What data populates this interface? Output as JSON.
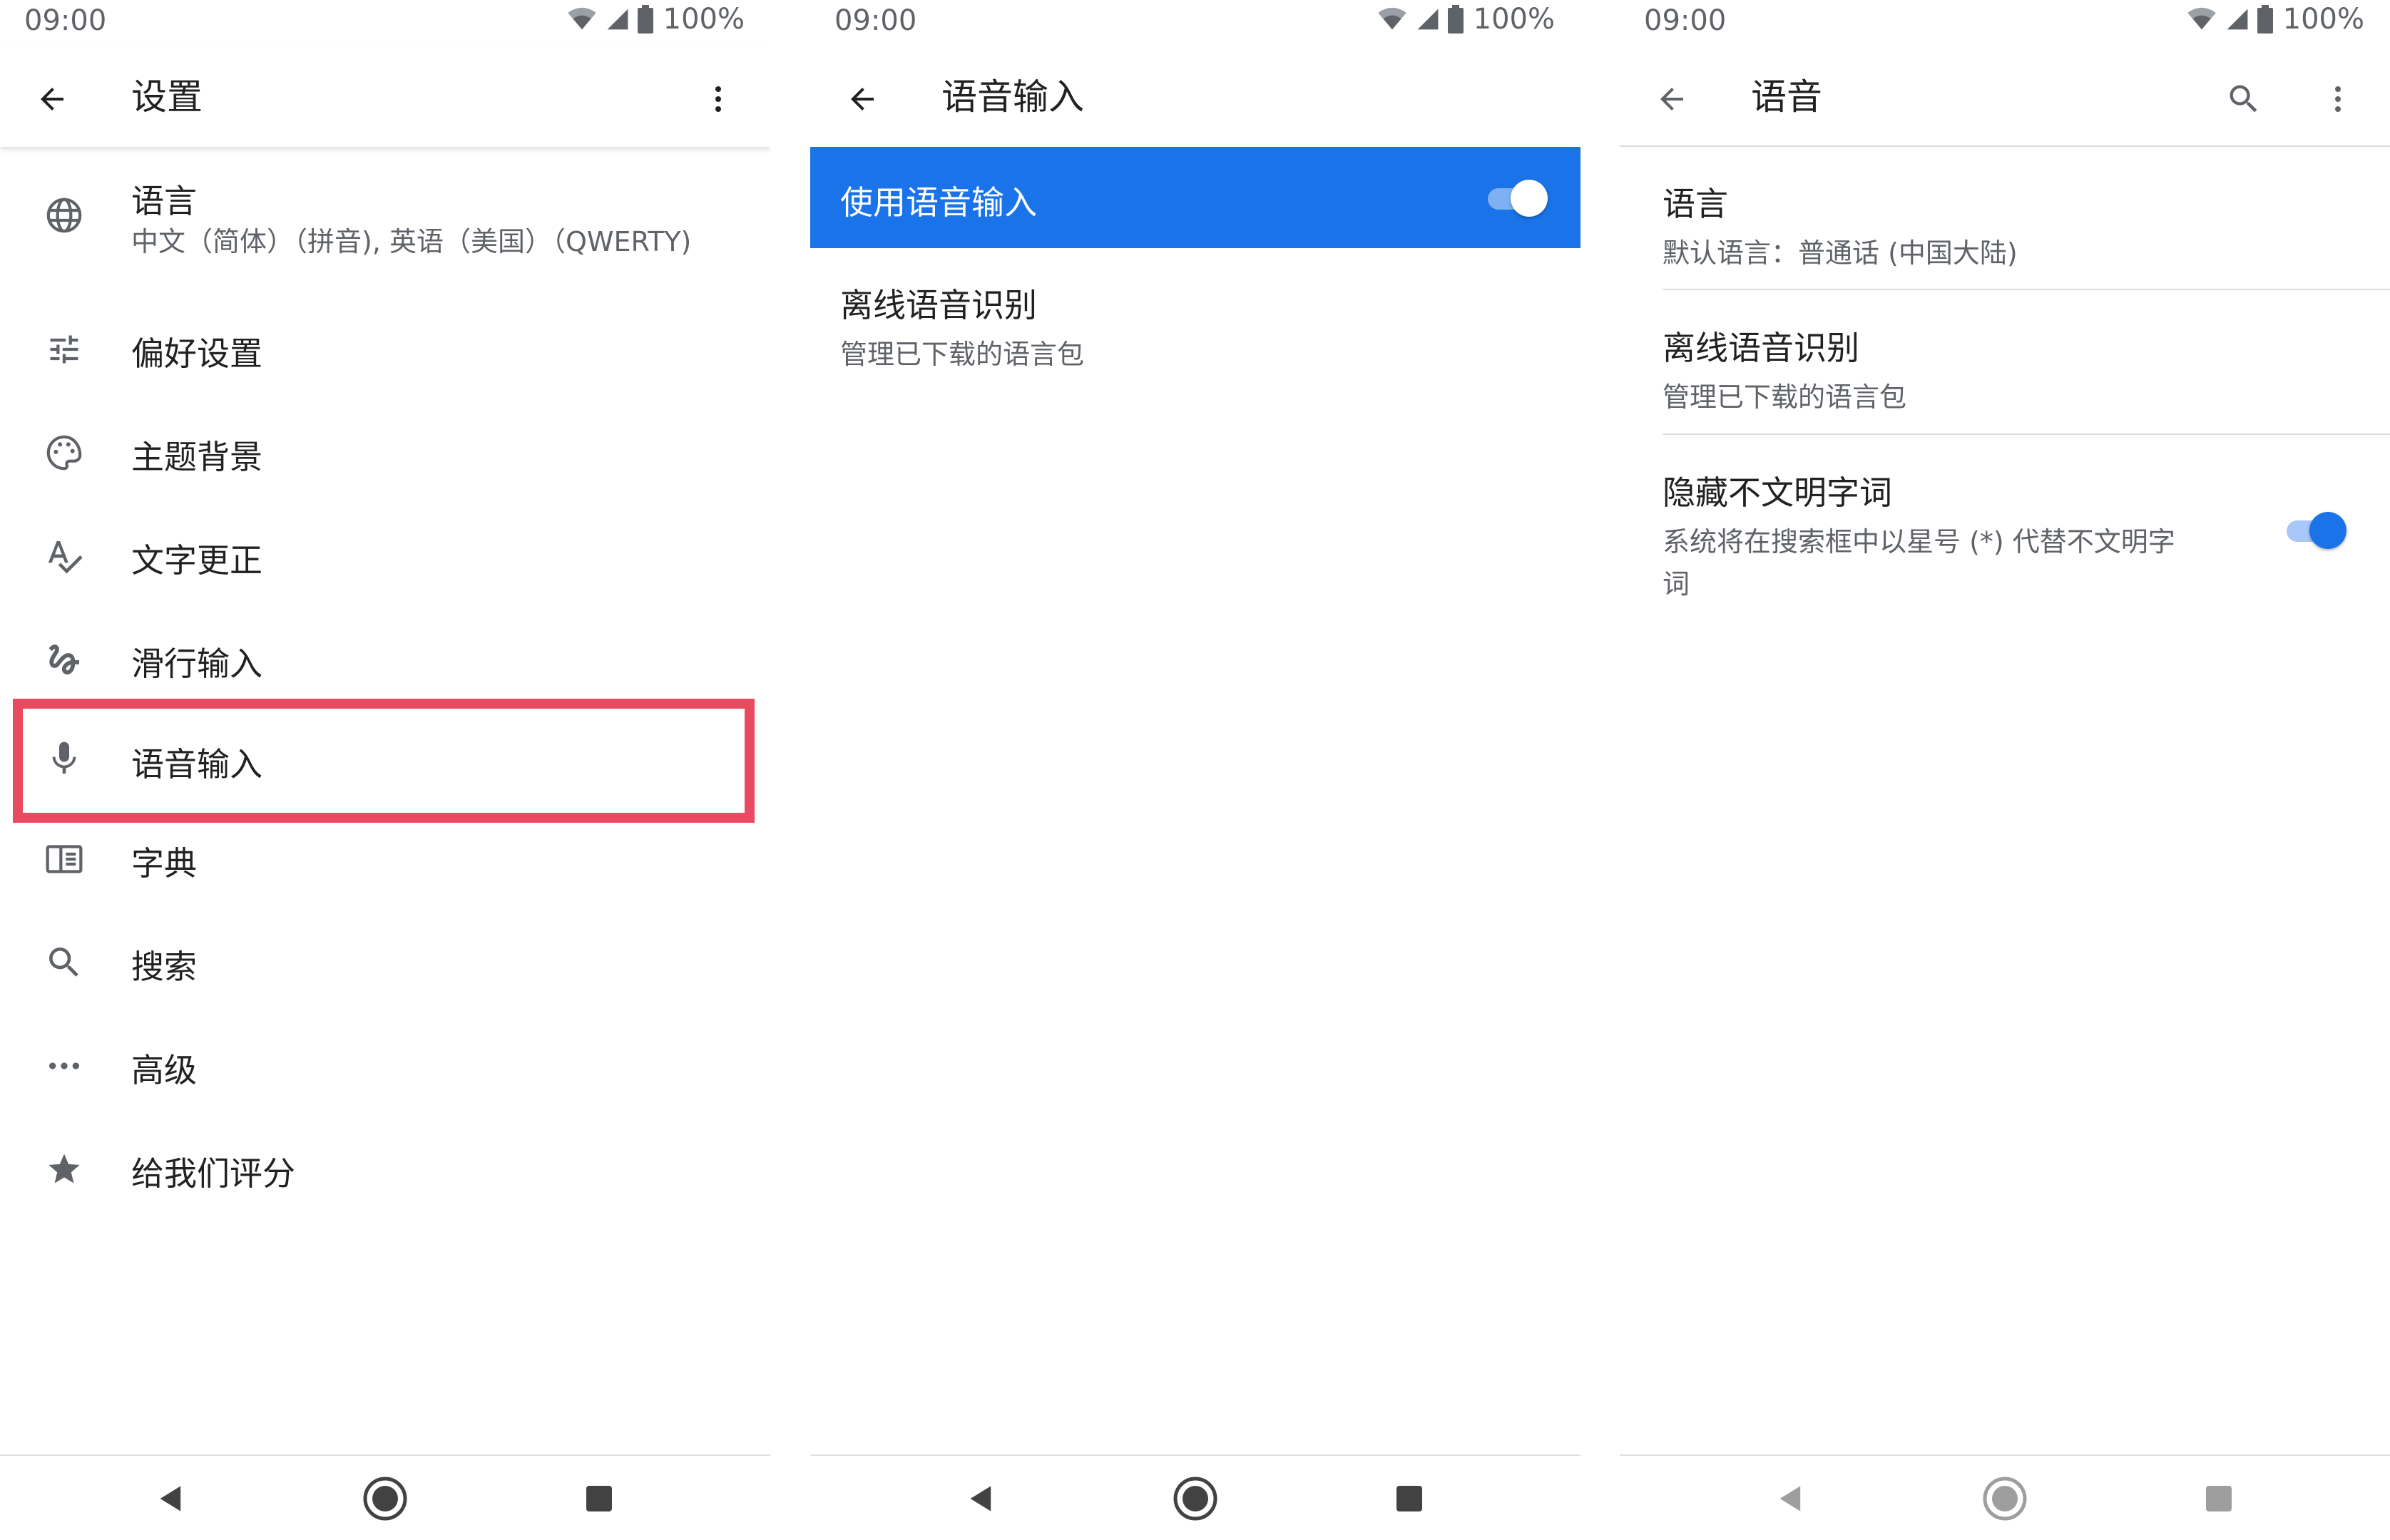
{
  "status_bar": {
    "time": "09:00",
    "battery": "100%"
  },
  "panel1": {
    "title": "设置",
    "items": [
      {
        "title": "语言",
        "subtitle": "中文（简体）（拼音), 英语（美国）（QWERTY)",
        "icon": "globe-icon"
      },
      {
        "title": "偏好设置",
        "icon": "tune-icon"
      },
      {
        "title": "主题背景",
        "icon": "palette-icon"
      },
      {
        "title": "文字更正",
        "icon": "spellcheck-icon"
      },
      {
        "title": "滑行输入",
        "icon": "gesture-icon"
      },
      {
        "title": "语音输入",
        "icon": "mic-icon"
      },
      {
        "title": "字典",
        "icon": "book-icon"
      },
      {
        "title": "搜索",
        "icon": "search-icon"
      },
      {
        "title": "高级",
        "icon": "more-horiz-icon"
      },
      {
        "title": "给我们评分",
        "icon": "star-icon"
      }
    ],
    "highlight_color": "#e84a5f"
  },
  "panel2": {
    "title": "语音输入",
    "toggle_row": {
      "label": "使用语音输入",
      "enabled": true
    },
    "items": [
      {
        "title": "离线语音识别",
        "subtitle": "管理已下载的语言包"
      }
    ],
    "accent": "#1a73e8"
  },
  "panel3": {
    "title": "语音",
    "items": [
      {
        "title": "语言",
        "subtitle": "默认语言：普通话 (中国大陆)"
      },
      {
        "title": "离线语音识别",
        "subtitle": "管理已下载的语言包"
      },
      {
        "title": "隐藏不文明字词",
        "subtitle_line1": "系统将在搜索框中以星号 (*) 代替不文明字",
        "subtitle_line2": "词",
        "enabled": true
      }
    ]
  }
}
